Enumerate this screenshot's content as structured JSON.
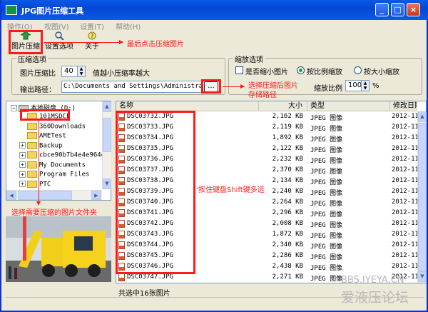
{
  "window": {
    "title": "JPG图片压缩工具",
    "caption_buttons": [
      "_",
      "□",
      "×"
    ]
  },
  "menu": [
    "操作(O)",
    "视图(V)",
    "设置(T)",
    "帮助(H)"
  ],
  "toolbar": [
    {
      "label": "图片压缩",
      "icon": "compress-icon"
    },
    {
      "label": "设置选项",
      "icon": "settings-icon"
    },
    {
      "label": "关于",
      "icon": "about-icon"
    }
  ],
  "compress_options": {
    "group_title": "压缩选项",
    "ratio_label": "图片压缩比",
    "ratio_value": "40",
    "ratio_hint": "值越小压缩率越大",
    "output_label": "输出路径：",
    "output_path": "C:\\Documents and Settings\\Administrator",
    "browse_label": "..."
  },
  "scale_options": {
    "group_title": "缩放选项",
    "checkbox_label": "是否缩小图片",
    "checkbox_checked": false,
    "radio_proportional": "按比例缩放",
    "radio_size": "按大小缩放",
    "selected": "按比例缩放",
    "scale_label": "缩放比例",
    "scale_value": "100",
    "scale_unit": "%"
  },
  "tree": {
    "root": "本地磁盘 (D:)",
    "items": [
      "101MSDCF",
      "360Downloads",
      "AMETest",
      "Backup",
      "cbce90b7b4e4e964d",
      "My Documents",
      "Program Files",
      "PTC"
    ],
    "expand_markers": [
      "",
      "",
      "",
      "+",
      "+",
      "+",
      "+",
      "+"
    ]
  },
  "file_list": {
    "columns": [
      "名称",
      "大小",
      "类型",
      "修改日期"
    ],
    "rows": [
      [
        "DSC03732.JPG",
        "2,162 KB",
        "JPEG 图像",
        "2012-11-"
      ],
      [
        "DSC03733.JPG",
        "2,119 KB",
        "JPEG 图像",
        "2012-11-"
      ],
      [
        "DSC03734.JPG",
        "1,892 KB",
        "JPEG 图像",
        "2012-11-"
      ],
      [
        "DSC03735.JPG",
        "2,122 KB",
        "JPEG 图像",
        "2012-11-"
      ],
      [
        "DSC03736.JPG",
        "2,232 KB",
        "JPEG 图像",
        "2012-11-"
      ],
      [
        "DSC03737.JPG",
        "2,370 KB",
        "JPEG 图像",
        "2012-11-"
      ],
      [
        "DSC03738.JPG",
        "2,134 KB",
        "JPEG 图像",
        "2012-11-"
      ],
      [
        "DSC03739.JPG",
        "2,240 KB",
        "JPEG 图像",
        "2012-11-"
      ],
      [
        "DSC03740.JPG",
        "2,264 KB",
        "JPEG 图像",
        "2012-11-"
      ],
      [
        "DSC03741.JPG",
        "2,296 KB",
        "JPEG 图像",
        "2012-11-"
      ],
      [
        "DSC03742.JPG",
        "2,008 KB",
        "JPEG 图像",
        "2012-11-"
      ],
      [
        "DSC03743.JPG",
        "1,872 KB",
        "JPEG 图像",
        "2012-11-"
      ],
      [
        "DSC03744.JPG",
        "2,340 KB",
        "JPEG 图像",
        "2012-11-"
      ],
      [
        "DSC03745.JPG",
        "2,286 KB",
        "JPEG 图像",
        "2012-11-"
      ],
      [
        "DSC03746.JPG",
        "2,438 KB",
        "JPEG 图像",
        "2012-11-"
      ],
      [
        "DSC03747.JPG",
        "2,271 KB",
        "JPEG 图像",
        "2012-11-"
      ]
    ]
  },
  "status": {
    "text": "共选中16张图片"
  },
  "annotations": {
    "click_compress": "最后点击压缩图片",
    "choose_path_1": "选择压缩后图片",
    "choose_path_2": "存储路径",
    "multi_select": "按住键盘Shift键多选",
    "choose_folder": "选择需要压缩的图片文件夹"
  },
  "watermark": {
    "line1": "BBS.IYEYA.CN",
    "line2": "爱液压论坛"
  },
  "colors": {
    "titlebar": "#0a5ae8",
    "annotation": "#ff1a1a",
    "window_bg": "#ece9d8"
  }
}
